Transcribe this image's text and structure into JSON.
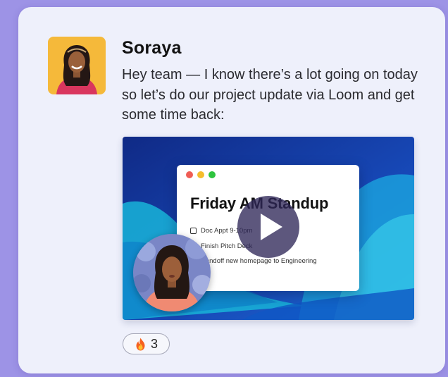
{
  "message": {
    "author": "Soraya",
    "text": "Hey team — I know there’s a lot going on today so let’s do our project update via Loom and get some time back:"
  },
  "video": {
    "window_title": "Friday AM Standup",
    "tasks": [
      "Doc Appt 9-10pm",
      "Finish Pitch Deck",
      "Handoff new homepage to Engineering"
    ]
  },
  "reaction": {
    "emoji": "🔥",
    "count": "3"
  },
  "colors": {
    "page_bg": "#9d93e6",
    "card_bg": "#eef0fb",
    "play_button": "#302858",
    "dot_red": "#ef5d55",
    "dot_yellow": "#f5bd2d",
    "dot_green": "#2fc43f"
  },
  "icons": [
    "avatar-photo",
    "play-icon",
    "presenter-bubble",
    "fire-icon",
    "checkbox-icon"
  ]
}
